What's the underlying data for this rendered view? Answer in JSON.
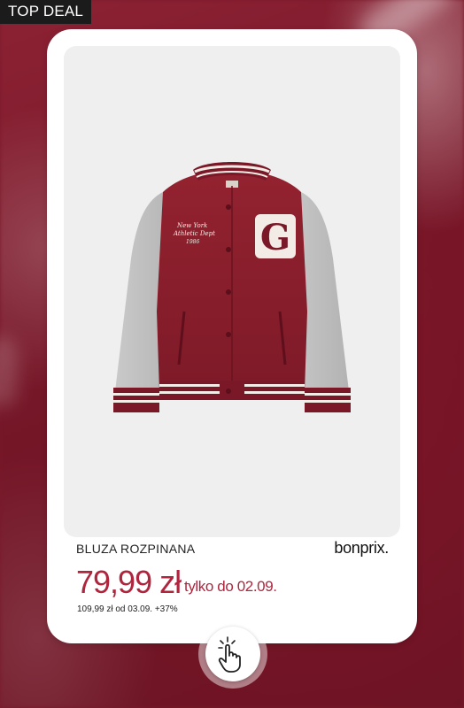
{
  "badge": {
    "label": "TOP DEAL"
  },
  "product": {
    "name": "BLUZA ROZPINANA",
    "image_alt": "Varsity jacket",
    "jacket_print": [
      "New York",
      "Athletic Dept",
      "1986"
    ],
    "jacket_letter": "G"
  },
  "brand": {
    "logo_text": "bonprix."
  },
  "pricing": {
    "current_price": "79,99 zł",
    "promo_note": "tylko do 02.09.",
    "regular_price_line": "109,99 zł od 03.09. +37%"
  },
  "colors": {
    "background": "#7a1a2a",
    "accent_price": "#b0253e",
    "badge_bg": "#1b1b1b",
    "jacket_body": "#8a1f2e",
    "jacket_sleeves": "#bdbdbd"
  },
  "icons": {
    "cta": "tap-hand-icon"
  }
}
